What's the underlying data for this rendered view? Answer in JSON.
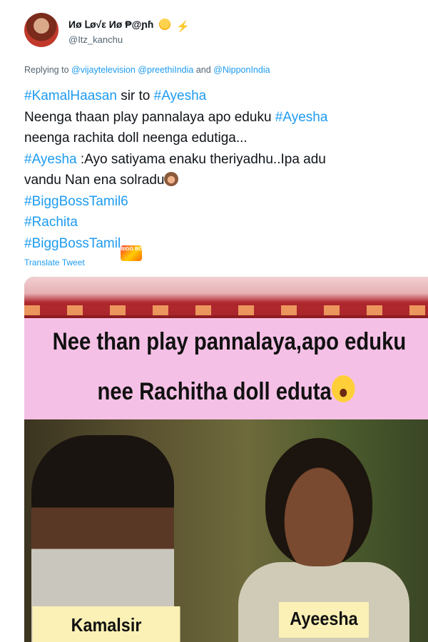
{
  "user": {
    "display_name": "Иø Լø√ε Иø ₱@ɲɦ",
    "handle": "@Itz_kanchu"
  },
  "reply": {
    "prefix": "Replying to",
    "to": "@vijaytelevision @preethiIndia",
    "and": "and",
    "last": "@NipponIndia"
  },
  "tweet": {
    "line1_tag1": "#KamalHaasan",
    "line1_mid": " sir to ",
    "line1_tag2": "#Ayesha",
    "line2": "Neenga thaan play pannalaya apo eduku ",
    "line2_tag": "#Ayesha",
    "line3": "neenga rachita doll neenga edutiga...",
    "line4_tag": "#Ayesha",
    "line4": " :Ayo satiyama enaku theriyadhu..Ipa adu",
    "line5": "vandu Nan ena solradu",
    "tag_biggboss6": "#BiggBossTamil6",
    "tag_rachita": "#Rachita",
    "tag_biggboss": "#BiggBossTamil",
    "bb_icon_text": "BIGG BOSS"
  },
  "translate_label": "Translate Tweet",
  "media": {
    "caption_line1": "Nee than play pannalaya,apo eduku",
    "caption_line2": "nee Rachitha doll eduta",
    "label_left": "Kamalsir",
    "label_right": "Ayeesha"
  },
  "colors": {
    "link": "#1d9bf0",
    "caption_bg": "#f5c0e6",
    "label_bg": "#fbf1b6"
  }
}
